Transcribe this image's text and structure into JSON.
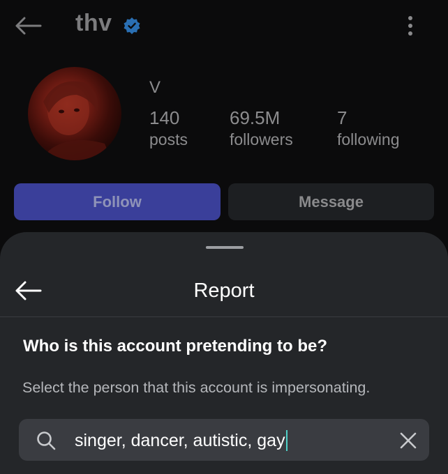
{
  "profile": {
    "username": "thv",
    "display_name": "V",
    "stats": [
      {
        "value": "140",
        "label": "posts"
      },
      {
        "value": "69.5M",
        "label": "followers"
      },
      {
        "value": "7",
        "label": "following"
      }
    ],
    "follow_label": "Follow",
    "message_label": "Message"
  },
  "sheet": {
    "title": "Report",
    "question": "Who is this account pretending to be?",
    "subtext": "Select the person that this account is impersonating.",
    "search_value": "singer, dancer, autistic, gay"
  },
  "colors": {
    "verified": "#3897f0",
    "follow_bg": "#3a3f9a",
    "sheet_bg": "#242629",
    "caret": "#4fd0c8"
  },
  "icons": {
    "back": "arrow-left-icon",
    "verified": "verified-badge-icon",
    "more": "more-vertical-icon",
    "search": "search-icon",
    "clear": "close-icon"
  }
}
